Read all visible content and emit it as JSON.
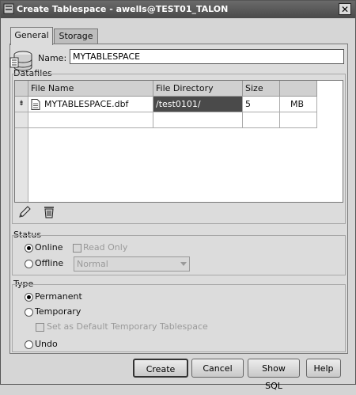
{
  "window": {
    "title": "Create Tablespace - awells@TEST01_TALON",
    "close_glyph": "✕"
  },
  "tabs": [
    {
      "label": "General",
      "active": true
    },
    {
      "label": "Storage",
      "active": false
    }
  ],
  "name": {
    "label": "Name:",
    "value": "MYTABLESPACE"
  },
  "datafiles": {
    "title": "Datafiles",
    "columns": [
      "File Name",
      "File Directory",
      "Size",
      ""
    ],
    "rows": [
      {
        "marker": "⇟",
        "file_name": "MYTABLESPACE.dbf",
        "file_directory": "/test0101/",
        "size": "5",
        "unit": "MB"
      }
    ],
    "tools": [
      {
        "icon": "pencil-icon"
      },
      {
        "icon": "trash-icon"
      }
    ]
  },
  "status": {
    "title": "Status",
    "online_label": "Online",
    "online_selected": true,
    "read_only_label": "Read Only",
    "offline_label": "Offline",
    "offline_selected": false,
    "offline_mode": "Normal"
  },
  "type": {
    "title": "Type",
    "permanent_label": "Permanent",
    "permanent_selected": true,
    "temporary_label": "Temporary",
    "default_temp_label": "Set as Default Temporary Tablespace",
    "undo_label": "Undo"
  },
  "buttons": {
    "create": "Create",
    "cancel": "Cancel",
    "show_sql": "Show SQL",
    "help": "Help"
  }
}
